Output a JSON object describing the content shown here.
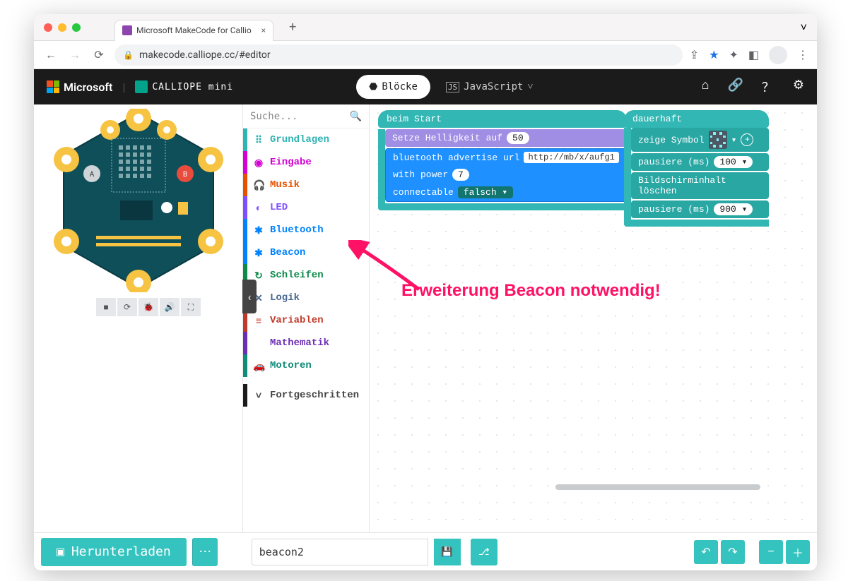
{
  "browser": {
    "tab_title": "Microsoft MakeCode for Callio",
    "url": "makecode.calliope.cc/#editor"
  },
  "header": {
    "brand_ms": "Microsoft",
    "brand_calliope": "CALLIOPE mini",
    "blocks_label": "Blöcke",
    "js_label": "JavaScript"
  },
  "search": {
    "placeholder": "Suche..."
  },
  "categories": [
    {
      "label": "Grundlagen",
      "cls": "c-grund",
      "icon": "⠿"
    },
    {
      "label": "Eingabe",
      "cls": "c-eingabe",
      "icon": "◉"
    },
    {
      "label": "Musik",
      "cls": "c-musik",
      "icon": "🎧"
    },
    {
      "label": "LED",
      "cls": "c-led",
      "icon": "◐"
    },
    {
      "label": "Bluetooth",
      "cls": "c-bt",
      "icon": "✱"
    },
    {
      "label": "Beacon",
      "cls": "c-beacon",
      "icon": "✱"
    },
    {
      "label": "Schleifen",
      "cls": "c-schleifen",
      "icon": "↻"
    },
    {
      "label": "Logik",
      "cls": "c-logik",
      "icon": "✕"
    },
    {
      "label": "Variablen",
      "cls": "c-var",
      "icon": "≡"
    },
    {
      "label": "Mathematik",
      "cls": "c-math",
      "icon": ""
    },
    {
      "label": "Motoren",
      "cls": "c-motor",
      "icon": "🚗"
    }
  ],
  "advanced_label": "Fortgeschritten",
  "blocks": {
    "on_start": "beim Start",
    "set_brightness": "Setze Helligkeit auf",
    "brightness_val": "50",
    "bt_adv": "bluetooth advertise url",
    "bt_url": "http://mb/x/aufg1",
    "bt_power": "with power",
    "bt_power_val": "7",
    "bt_conn": "connectable",
    "bt_conn_val": "falsch ▾",
    "forever": "dauerhaft",
    "show_icon": "zeige Symbol",
    "pause1": "pausiere (ms)",
    "pause1_val": "100 ▾",
    "clear": "Bildschirminhalt löschen",
    "pause2": "pausiere (ms)",
    "pause2_val": "900 ▾"
  },
  "annotation": "Erweiterung Beacon notwendig!",
  "footer": {
    "download": "Herunterladen",
    "project_name": "beacon2"
  }
}
